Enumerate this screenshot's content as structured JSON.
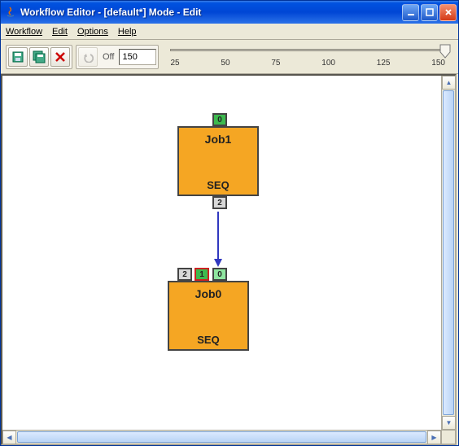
{
  "window": {
    "title": "Workflow Editor - [default*]  Mode - Edit"
  },
  "menu": {
    "workflow": "Workflow",
    "edit": "Edit",
    "options": "Options",
    "help": "Help"
  },
  "toolbar": {
    "off_label": "Off",
    "zoom_value": "150"
  },
  "slider": {
    "ticks": [
      "25",
      "50",
      "75",
      "100",
      "125",
      "150"
    ],
    "value": 150,
    "min": 25,
    "max": 150
  },
  "nodes": {
    "job1": {
      "title": "Job1",
      "mode": "SEQ",
      "in_ports": [
        {
          "label": "0",
          "color": "green"
        }
      ],
      "out_ports": [
        {
          "label": "2"
        }
      ]
    },
    "job0": {
      "title": "Job0",
      "mode": "SEQ",
      "in_ports": [
        {
          "label": "2",
          "color": "gray"
        },
        {
          "label": "1",
          "color": "green-red"
        },
        {
          "label": "0",
          "color": "lightgreen"
        }
      ]
    }
  },
  "edges": [
    {
      "from": "job1.out.2",
      "to": "job0.in.0"
    }
  ]
}
